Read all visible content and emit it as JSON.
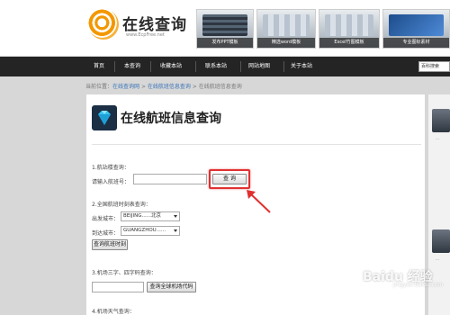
{
  "header": {
    "logo_text": "在线查询",
    "logo_url": "www.EcpFree.net",
    "ads": [
      {
        "caption": "发布PPT模板",
        "style": "dark"
      },
      {
        "caption": "精选word模板",
        "style": "light"
      },
      {
        "caption": "Excel竹图模板",
        "style": "light"
      },
      {
        "caption": "专业图标素材",
        "style": "blue"
      }
    ]
  },
  "nav": {
    "items": [
      "首页",
      "本查询",
      "收藏本站",
      "联系本站",
      "网站地图",
      "关于本站"
    ],
    "search_placeholder": "百科搜索"
  },
  "breadcrumb": {
    "prefix": "当前位置：",
    "crumbs": [
      "在线查询网",
      "在线航班信息查询"
    ],
    "current": "在线航班信息查询",
    "separator": " > "
  },
  "main": {
    "title": "在线航班信息查询",
    "section1": {
      "heading": "1.航站楼查询：",
      "label": "请输入航班号：",
      "input_value": "",
      "button": "查 询"
    },
    "section2": {
      "heading": "2.全国航班时刻表查询：",
      "depart_label": "出发城市：",
      "depart_value": "BEIJING......北京",
      "arrive_label": "到达城市：",
      "arrive_value": "GUANGZHOU......",
      "button": "查询航班时刻"
    },
    "section3": {
      "heading": "3.机场三字、四字码查询：",
      "input_value": "",
      "button": "查询全球机场代码"
    },
    "section4": {
      "heading": "4.机场天气查询："
    }
  },
  "right": {
    "snippets": [
      "…",
      "…"
    ]
  },
  "watermark": {
    "text": "Baidu 经验",
    "sub": "jingyan.baidu.com"
  },
  "colors": {
    "nav_bg": "#242424",
    "highlight": "#e03030",
    "link": "#3a74b8",
    "page_bg": "#d7d7d7"
  }
}
